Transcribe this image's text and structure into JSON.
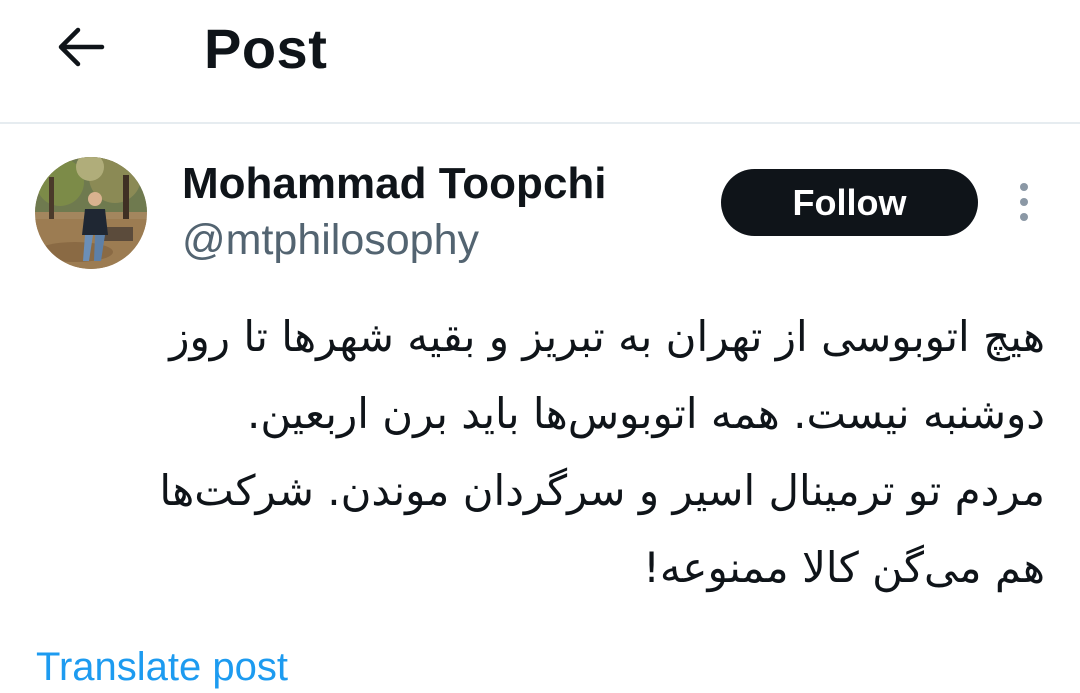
{
  "header": {
    "back_icon": "arrow-left-icon",
    "title": "Post"
  },
  "post": {
    "author": {
      "display_name": "Mohammad Toopchi",
      "handle": "@mtphilosophy",
      "avatar": "avatar-photo"
    },
    "follow_label": "Follow",
    "more_icon": "more-vertical-icon",
    "text_lines": [
      "هیچ اتوبوسی از تهران به تبریز و بقیه شهرها تا روز",
      "دوشنبه نیست. همه اتوبوس‌ها باید برن اربعین.",
      "مردم تو ترمینال اسیر و سرگردان موندن. شرکت‌ها",
      "هم می‌گن کالا ممنوعه!"
    ],
    "translate_label": "Translate post"
  },
  "colors": {
    "text_primary": "#0f1419",
    "text_secondary": "#536471",
    "link": "#1d9bf0",
    "follow_bg": "#0f1419",
    "follow_text": "#ffffff",
    "divider": "#e6ecf0"
  }
}
